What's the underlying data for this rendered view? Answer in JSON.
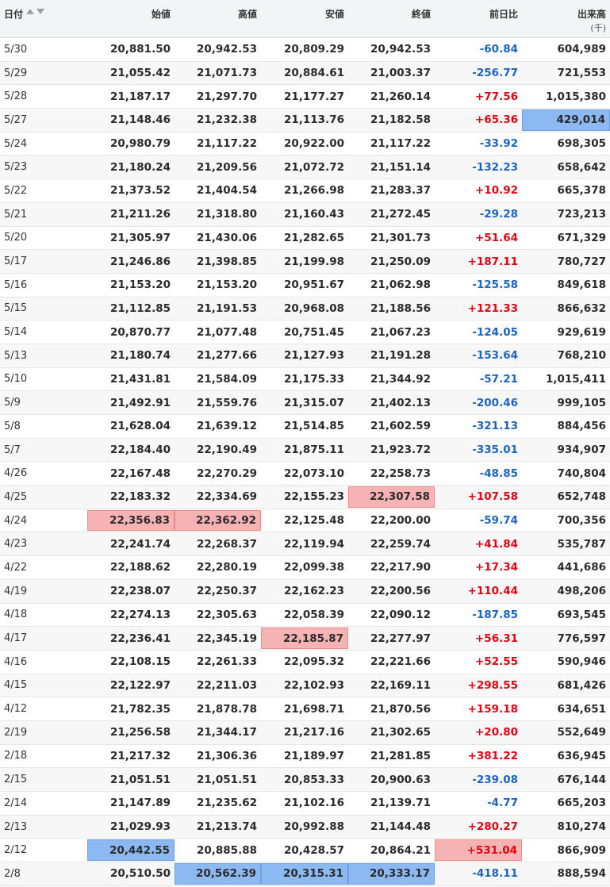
{
  "header": {
    "date": "日付",
    "open": "始値",
    "high": "高値",
    "low": "安値",
    "close": "終値",
    "change": "前日比",
    "volume": "出来高",
    "volume_unit": "(千)"
  },
  "colors": {
    "positive": "#e60012",
    "negative": "#1a64c4",
    "highlight_red": "#f7b3b3",
    "highlight_blue": "#8cb9f2"
  },
  "rows": [
    {
      "date": "5/30",
      "open": "20,881.50",
      "high": "20,942.53",
      "low": "20,809.29",
      "close": "20,942.53",
      "change": "-60.84",
      "volume": "604,989"
    },
    {
      "date": "5/29",
      "open": "21,055.42",
      "high": "21,071.73",
      "low": "20,884.61",
      "close": "21,003.37",
      "change": "-256.77",
      "volume": "721,553"
    },
    {
      "date": "5/28",
      "open": "21,187.17",
      "high": "21,297.70",
      "low": "21,177.27",
      "close": "21,260.14",
      "change": "+77.56",
      "volume": "1,015,380"
    },
    {
      "date": "5/27",
      "open": "21,148.46",
      "high": "21,232.38",
      "low": "21,113.76",
      "close": "21,182.58",
      "change": "+65.36",
      "volume": "429,014",
      "hl": {
        "volume": "blue"
      }
    },
    {
      "date": "5/24",
      "open": "20,980.79",
      "high": "21,117.22",
      "low": "20,922.00",
      "close": "21,117.22",
      "change": "-33.92",
      "volume": "698,305"
    },
    {
      "date": "5/23",
      "open": "21,180.24",
      "high": "21,209.56",
      "low": "21,072.72",
      "close": "21,151.14",
      "change": "-132.23",
      "volume": "658,642"
    },
    {
      "date": "5/22",
      "open": "21,373.52",
      "high": "21,404.54",
      "low": "21,266.98",
      "close": "21,283.37",
      "change": "+10.92",
      "volume": "665,378"
    },
    {
      "date": "5/21",
      "open": "21,211.26",
      "high": "21,318.80",
      "low": "21,160.43",
      "close": "21,272.45",
      "change": "-29.28",
      "volume": "723,213"
    },
    {
      "date": "5/20",
      "open": "21,305.97",
      "high": "21,430.06",
      "low": "21,282.65",
      "close": "21,301.73",
      "change": "+51.64",
      "volume": "671,329"
    },
    {
      "date": "5/17",
      "open": "21,246.86",
      "high": "21,398.85",
      "low": "21,199.98",
      "close": "21,250.09",
      "change": "+187.11",
      "volume": "780,727"
    },
    {
      "date": "5/16",
      "open": "21,153.20",
      "high": "21,153.20",
      "low": "20,951.67",
      "close": "21,062.98",
      "change": "-125.58",
      "volume": "849,618"
    },
    {
      "date": "5/15",
      "open": "21,112.85",
      "high": "21,191.53",
      "low": "20,968.08",
      "close": "21,188.56",
      "change": "+121.33",
      "volume": "866,632"
    },
    {
      "date": "5/14",
      "open": "20,870.77",
      "high": "21,077.48",
      "low": "20,751.45",
      "close": "21,067.23",
      "change": "-124.05",
      "volume": "929,619"
    },
    {
      "date": "5/13",
      "open": "21,180.74",
      "high": "21,277.66",
      "low": "21,127.93",
      "close": "21,191.28",
      "change": "-153.64",
      "volume": "768,210"
    },
    {
      "date": "5/10",
      "open": "21,431.81",
      "high": "21,584.09",
      "low": "21,175.33",
      "close": "21,344.92",
      "change": "-57.21",
      "volume": "1,015,411"
    },
    {
      "date": "5/9",
      "open": "21,492.91",
      "high": "21,559.76",
      "low": "21,315.07",
      "close": "21,402.13",
      "change": "-200.46",
      "volume": "999,105"
    },
    {
      "date": "5/8",
      "open": "21,628.04",
      "high": "21,639.12",
      "low": "21,514.85",
      "close": "21,602.59",
      "change": "-321.13",
      "volume": "884,456"
    },
    {
      "date": "5/7",
      "open": "22,184.40",
      "high": "22,190.49",
      "low": "21,875.11",
      "close": "21,923.72",
      "change": "-335.01",
      "volume": "934,907"
    },
    {
      "date": "4/26",
      "open": "22,167.48",
      "high": "22,270.29",
      "low": "22,073.10",
      "close": "22,258.73",
      "change": "-48.85",
      "volume": "740,804"
    },
    {
      "date": "4/25",
      "open": "22,183.32",
      "high": "22,334.69",
      "low": "22,155.23",
      "close": "22,307.58",
      "change": "+107.58",
      "volume": "652,748",
      "hl": {
        "close": "red"
      }
    },
    {
      "date": "4/24",
      "open": "22,356.83",
      "high": "22,362.92",
      "low": "22,125.48",
      "close": "22,200.00",
      "change": "-59.74",
      "volume": "700,356",
      "hl": {
        "open": "red",
        "high": "red"
      }
    },
    {
      "date": "4/23",
      "open": "22,241.74",
      "high": "22,268.37",
      "low": "22,119.94",
      "close": "22,259.74",
      "change": "+41.84",
      "volume": "535,787"
    },
    {
      "date": "4/22",
      "open": "22,188.62",
      "high": "22,280.19",
      "low": "22,099.38",
      "close": "22,217.90",
      "change": "+17.34",
      "volume": "441,686"
    },
    {
      "date": "4/19",
      "open": "22,238.07",
      "high": "22,250.37",
      "low": "22,162.23",
      "close": "22,200.56",
      "change": "+110.44",
      "volume": "498,206"
    },
    {
      "date": "4/18",
      "open": "22,274.13",
      "high": "22,305.63",
      "low": "22,058.39",
      "close": "22,090.12",
      "change": "-187.85",
      "volume": "693,545"
    },
    {
      "date": "4/17",
      "open": "22,236.41",
      "high": "22,345.19",
      "low": "22,185.87",
      "close": "22,277.97",
      "change": "+56.31",
      "volume": "776,597",
      "hl": {
        "low": "red"
      }
    },
    {
      "date": "4/16",
      "open": "22,108.15",
      "high": "22,261.33",
      "low": "22,095.32",
      "close": "22,221.66",
      "change": "+52.55",
      "volume": "590,946"
    },
    {
      "date": "4/15",
      "open": "22,122.97",
      "high": "22,211.03",
      "low": "22,102.93",
      "close": "22,169.11",
      "change": "+298.55",
      "volume": "681,426"
    },
    {
      "date": "4/12",
      "open": "21,782.35",
      "high": "21,878.78",
      "low": "21,698.71",
      "close": "21,870.56",
      "change": "+159.18",
      "volume": "634,651"
    },
    {
      "date": "2/19",
      "open": "21,256.58",
      "high": "21,344.17",
      "low": "21,217.16",
      "close": "21,302.65",
      "change": "+20.80",
      "volume": "552,649"
    },
    {
      "date": "2/18",
      "open": "21,217.32",
      "high": "21,306.36",
      "low": "21,189.97",
      "close": "21,281.85",
      "change": "+381.22",
      "volume": "636,945"
    },
    {
      "date": "2/15",
      "open": "21,051.51",
      "high": "21,051.51",
      "low": "20,853.33",
      "close": "20,900.63",
      "change": "-239.08",
      "volume": "676,144"
    },
    {
      "date": "2/14",
      "open": "21,147.89",
      "high": "21,235.62",
      "low": "21,102.16",
      "close": "21,139.71",
      "change": "-4.77",
      "volume": "665,203"
    },
    {
      "date": "2/13",
      "open": "21,029.93",
      "high": "21,213.74",
      "low": "20,992.88",
      "close": "21,144.48",
      "change": "+280.27",
      "volume": "810,274"
    },
    {
      "date": "2/12",
      "open": "20,442.55",
      "high": "20,885.88",
      "low": "20,428.57",
      "close": "20,864.21",
      "change": "+531.04",
      "volume": "866,909",
      "hl": {
        "open": "blue",
        "change": "red"
      }
    },
    {
      "date": "2/8",
      "open": "20,510.50",
      "high": "20,562.39",
      "low": "20,315.31",
      "close": "20,333.17",
      "change": "-418.11",
      "volume": "888,594",
      "hl": {
        "high": "blue",
        "low": "blue",
        "close": "blue"
      }
    }
  ]
}
